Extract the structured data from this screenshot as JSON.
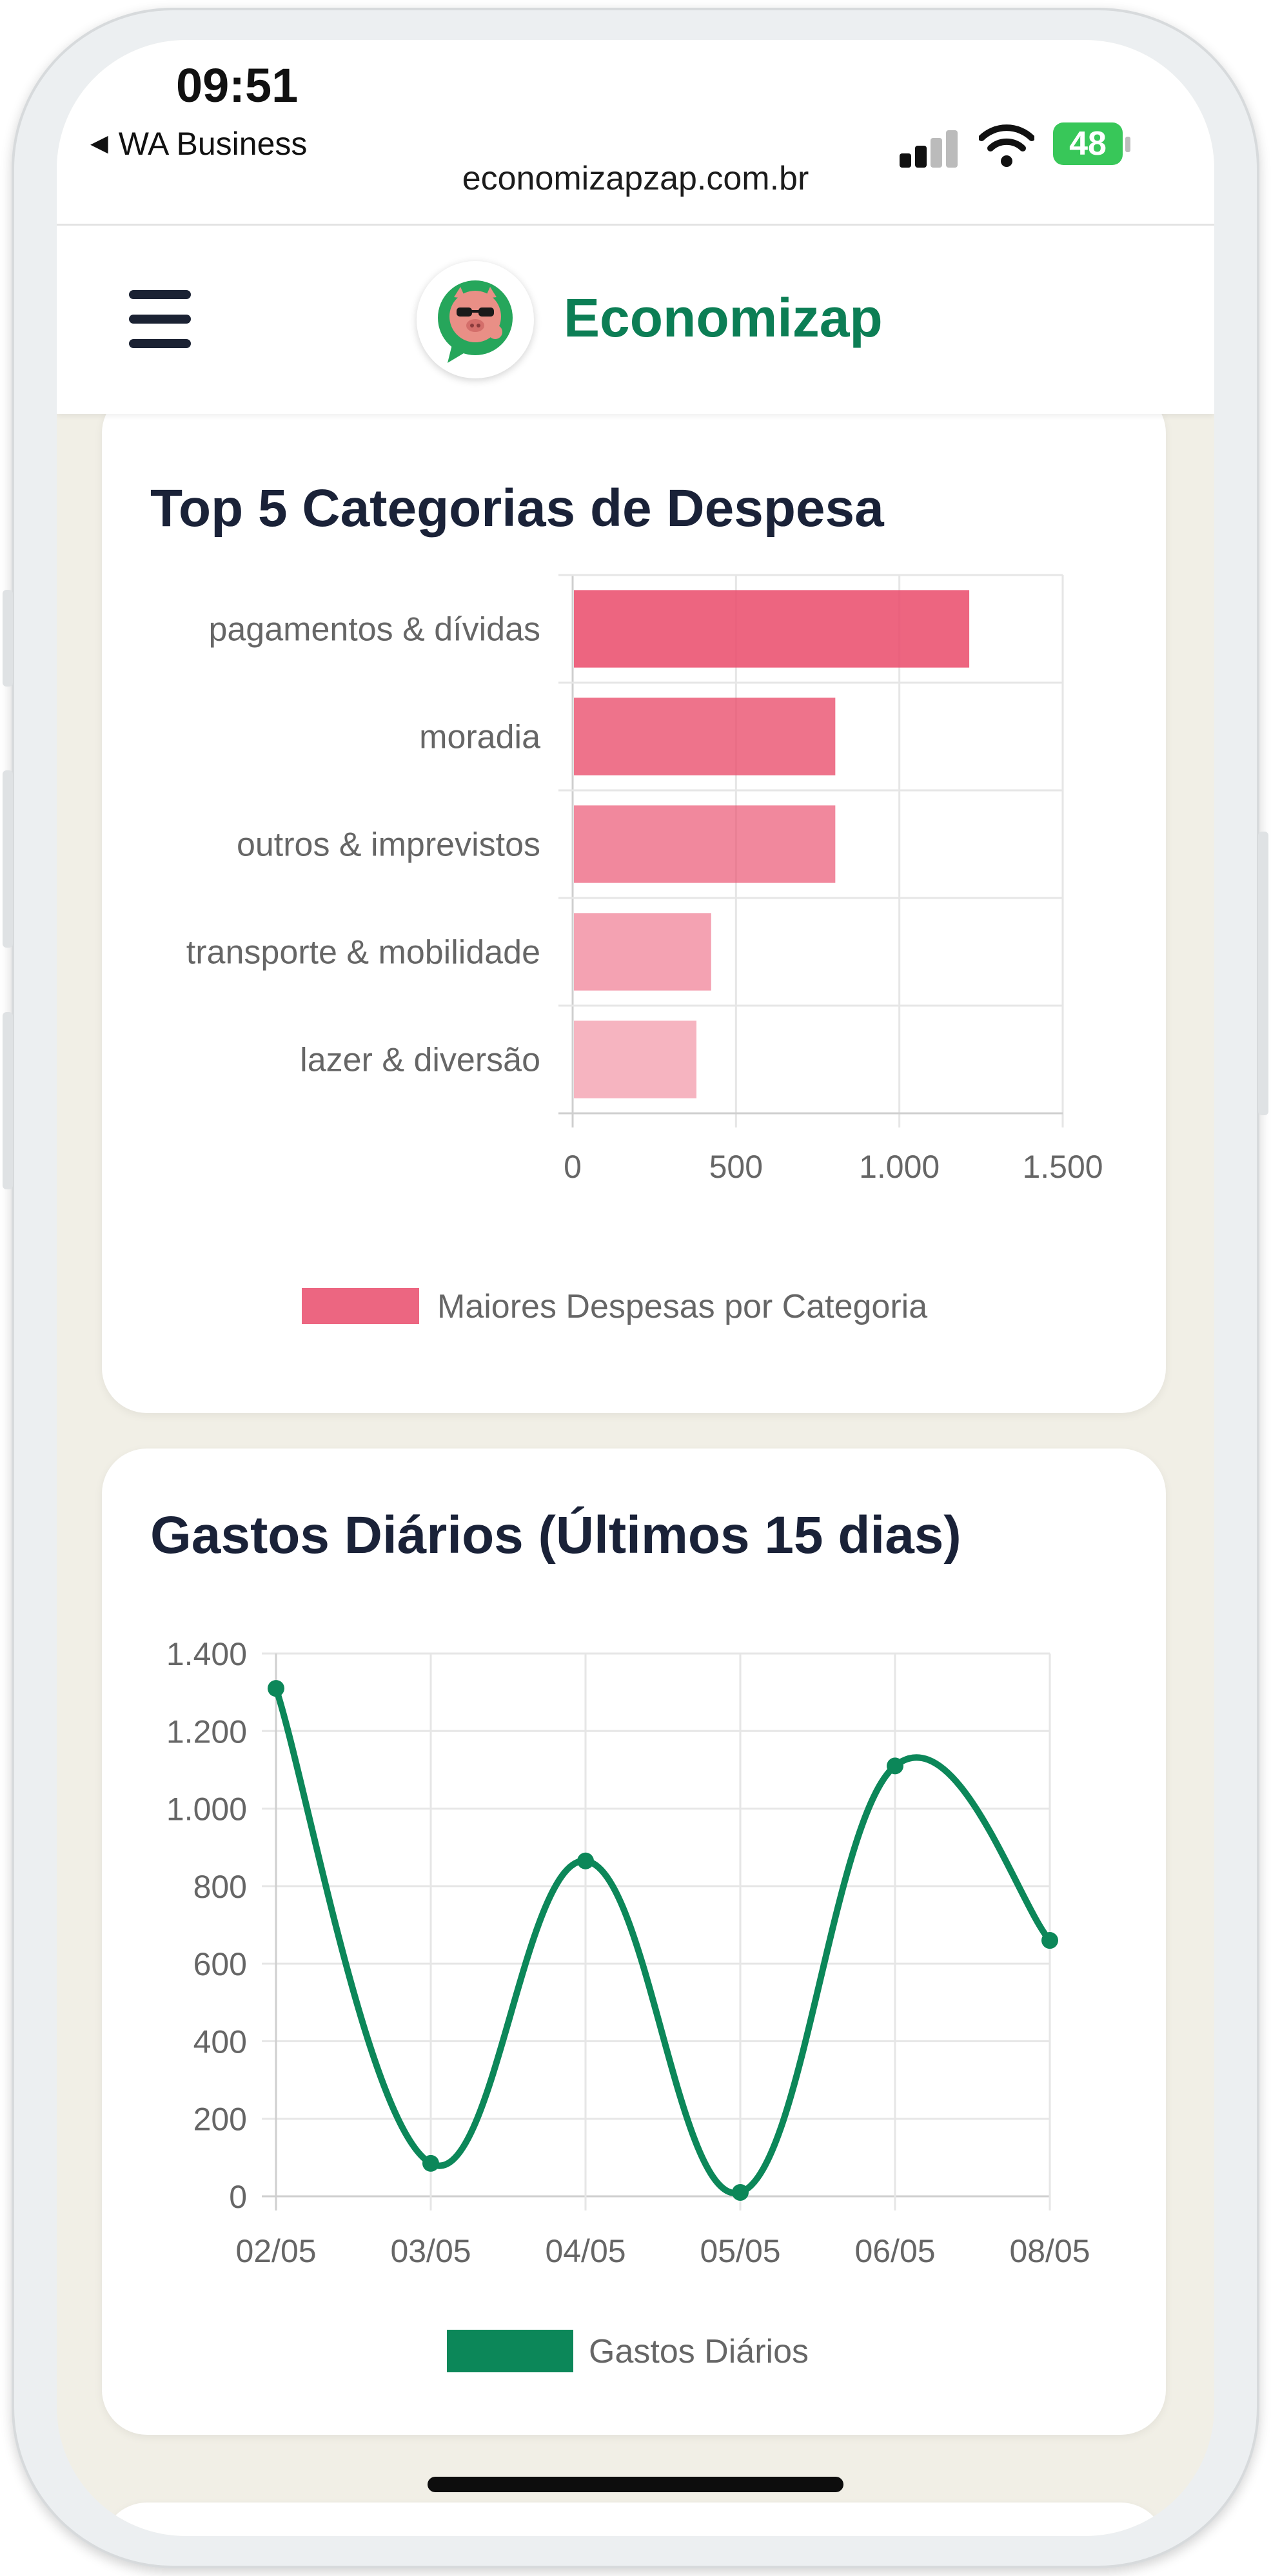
{
  "status_bar": {
    "time": "09:51",
    "back_app": "WA Business",
    "url": "economizapzap.com.br",
    "battery": "48"
  },
  "header": {
    "brand": "Economizap",
    "logo_icon": "pig-with-sunglasses-logo-icon",
    "menu_icon": "hamburger-menu-icon"
  },
  "colors": {
    "brand_green": "#0c7e55",
    "bar_red": "#ec6681",
    "bar_red_light": "#f4b3c0",
    "line_green": "#0c8759"
  },
  "top_categories": {
    "title": "Top 5 Categorias de Despesa",
    "legend": "Maiores Despesas por Categoria"
  },
  "daily_spending": {
    "title": "Gastos Diários (Últimos 15 dias)",
    "legend": "Gastos Diários"
  },
  "chart_data": [
    {
      "type": "bar",
      "orientation": "horizontal",
      "title": "Top 5 Categorias de Despesa",
      "categories": [
        "pagamentos & dívidas",
        "moradia",
        "outros & imprevistos",
        "transporte & mobilidade",
        "lazer & diversão"
      ],
      "series": [
        {
          "name": "Maiores Despesas por Categoria",
          "values": [
            1210,
            800,
            800,
            420,
            375
          ]
        }
      ],
      "xlim": [
        0,
        1500
      ],
      "ticks": [
        "0",
        "500",
        "1.000",
        "1.500"
      ],
      "grid": true,
      "legend_position": "bottom"
    },
    {
      "type": "line",
      "title": "Gastos Diários (Últimos 15 dias)",
      "x": [
        "02/05",
        "03/05",
        "04/05",
        "05/05",
        "06/05",
        "08/05"
      ],
      "series": [
        {
          "name": "Gastos Diários",
          "values": [
            1310,
            85,
            865,
            10,
            1110,
            660
          ]
        }
      ],
      "ylim": [
        0,
        1400
      ],
      "yticks": [
        "0",
        "200",
        "400",
        "600",
        "800",
        "1.000",
        "1.200",
        "1.400"
      ],
      "grid": true,
      "smooth": true,
      "legend_position": "bottom"
    }
  ]
}
